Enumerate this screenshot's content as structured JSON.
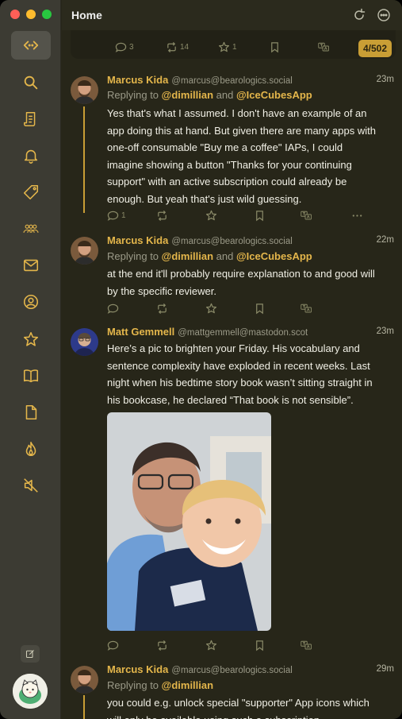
{
  "window": {
    "title": "Home"
  },
  "timeline": {
    "counter": "4/502",
    "previous_post": {
      "replies": "3",
      "boosts": "14",
      "favorites": "1"
    }
  },
  "posts": [
    {
      "author": "Marcus Kida",
      "handle": "@marcus@bearologics.social",
      "time": "23m",
      "reply_prefix": "Replying to ",
      "reply_to_1": "@dimillian",
      "reply_and": " and ",
      "reply_to_2": "@IceCubesApp",
      "lines": [
        "Yes that's what I assumed. I don't have an example of an",
        "app doing this at hand. But given there are many apps with",
        "one-off consumable \"Buy me a coffee\" IAPs, I could",
        "imagine showing a button \"Thanks for your continuing",
        "support\" with an active subscription could already be",
        "enough. But yeah that's just wild guessing."
      ],
      "replies": "1"
    },
    {
      "author": "Marcus Kida",
      "handle": "@marcus@bearologics.social",
      "time": "22m",
      "reply_prefix": "Replying to ",
      "reply_to_1": "@dimillian",
      "reply_and": " and ",
      "reply_to_2": "@IceCubesApp",
      "lines": [
        "at the end it'll probably require explanation to and good will",
        "by the specific reviewer."
      ]
    },
    {
      "author": "Matt Gemmell",
      "handle": "@mattgemmell@mastodon.scot",
      "time": "23m",
      "lines": [
        "Here’s a pic to brighten your Friday. His vocabulary and",
        "sentence complexity have exploded in recent weeks. Last",
        "night when his bedtime story book wasn’t sitting straight in",
        "his bookcase, he declared “That book is not sensible”."
      ]
    },
    {
      "author": "Marcus Kida",
      "handle": "@marcus@bearologics.social",
      "time": "29m",
      "reply_prefix": "Replying to ",
      "reply_to_1": "@dimillian",
      "lines": [
        "you could e.g. unlock special \"supporter\" App icons which",
        "will only be available using such a subscription"
      ]
    }
  ],
  "colors": {
    "accent": "#e4b64b",
    "background": "#272619",
    "sidebar": "#3c3b33"
  },
  "sidebar_icons": [
    "timeline-switch-icon",
    "search-icon",
    "lists-icon",
    "notifications-icon",
    "tags-icon",
    "followers-icon",
    "messages-icon",
    "profile-icon",
    "favorites-icon",
    "bookmarks-icon",
    "drafts-icon",
    "trending-icon",
    "muted-icon"
  ]
}
